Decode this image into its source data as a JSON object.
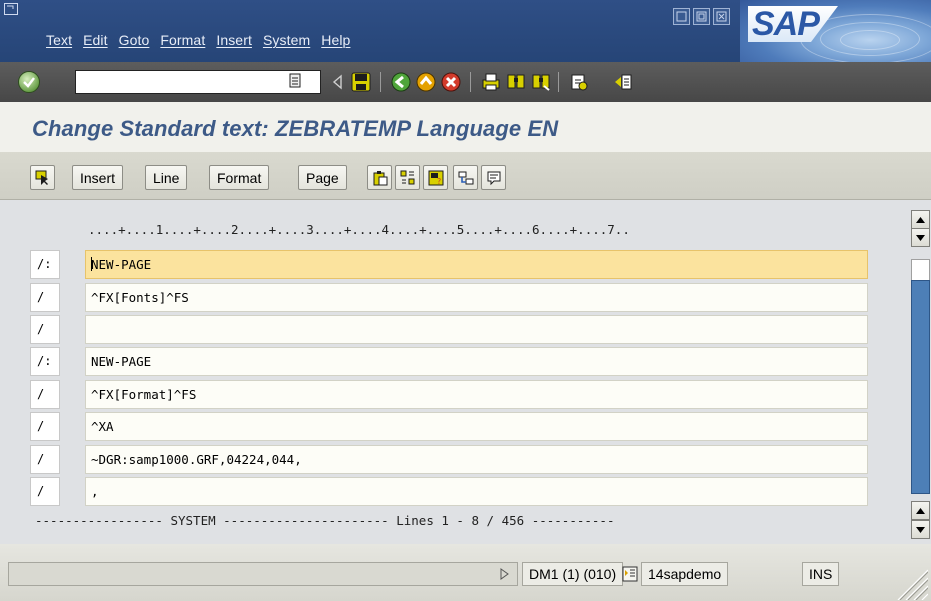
{
  "menubar": {
    "items": [
      "Text",
      "Edit",
      "Goto",
      "Format",
      "Insert",
      "System",
      "Help"
    ],
    "logo_text": "SAP"
  },
  "toolbar": {
    "command_value": "",
    "icons": [
      "enter-icon",
      "back-nav-icon",
      "save-icon",
      "back-icon",
      "exit-icon",
      "cancel-icon",
      "print-icon",
      "find-icon",
      "find-next-icon",
      "first-page-icon",
      "layout-icon"
    ]
  },
  "page": {
    "title": "Change Standard text: ZEBRATEMP Language EN"
  },
  "app_toolbar": {
    "insert_label": "Insert",
    "line_label": "Line",
    "format_label": "Format",
    "page_label": "Page"
  },
  "editor": {
    "ruler": "....+....1....+....2....+....3....+....4....+....5....+....6....+....7..",
    "lines": [
      {
        "format": "/:",
        "text": "NEW-PAGE"
      },
      {
        "format": "/",
        "text": "^FX[Fonts]^FS"
      },
      {
        "format": "/",
        "text": ""
      },
      {
        "format": "/:",
        "text": "NEW-PAGE"
      },
      {
        "format": "/",
        "text": "^FX[Format]^FS"
      },
      {
        "format": "/",
        "text": "^XA"
      },
      {
        "format": "/",
        "text": "~DGR:samp1000.GRF,04224,044,"
      },
      {
        "format": "/",
        "text": ","
      }
    ],
    "status_line": "----------------- SYSTEM ---------------------- Lines 1 - 8 / 456 -----------"
  },
  "statusbar": {
    "system": "DM1 (1) (010)",
    "server": "14sapdemo",
    "mode": "INS"
  },
  "colors": {
    "menubar": "#2f4f86",
    "title": "#3d5a87",
    "active_line": "#fbe39e",
    "scroll_track": "#4d7fb7"
  }
}
